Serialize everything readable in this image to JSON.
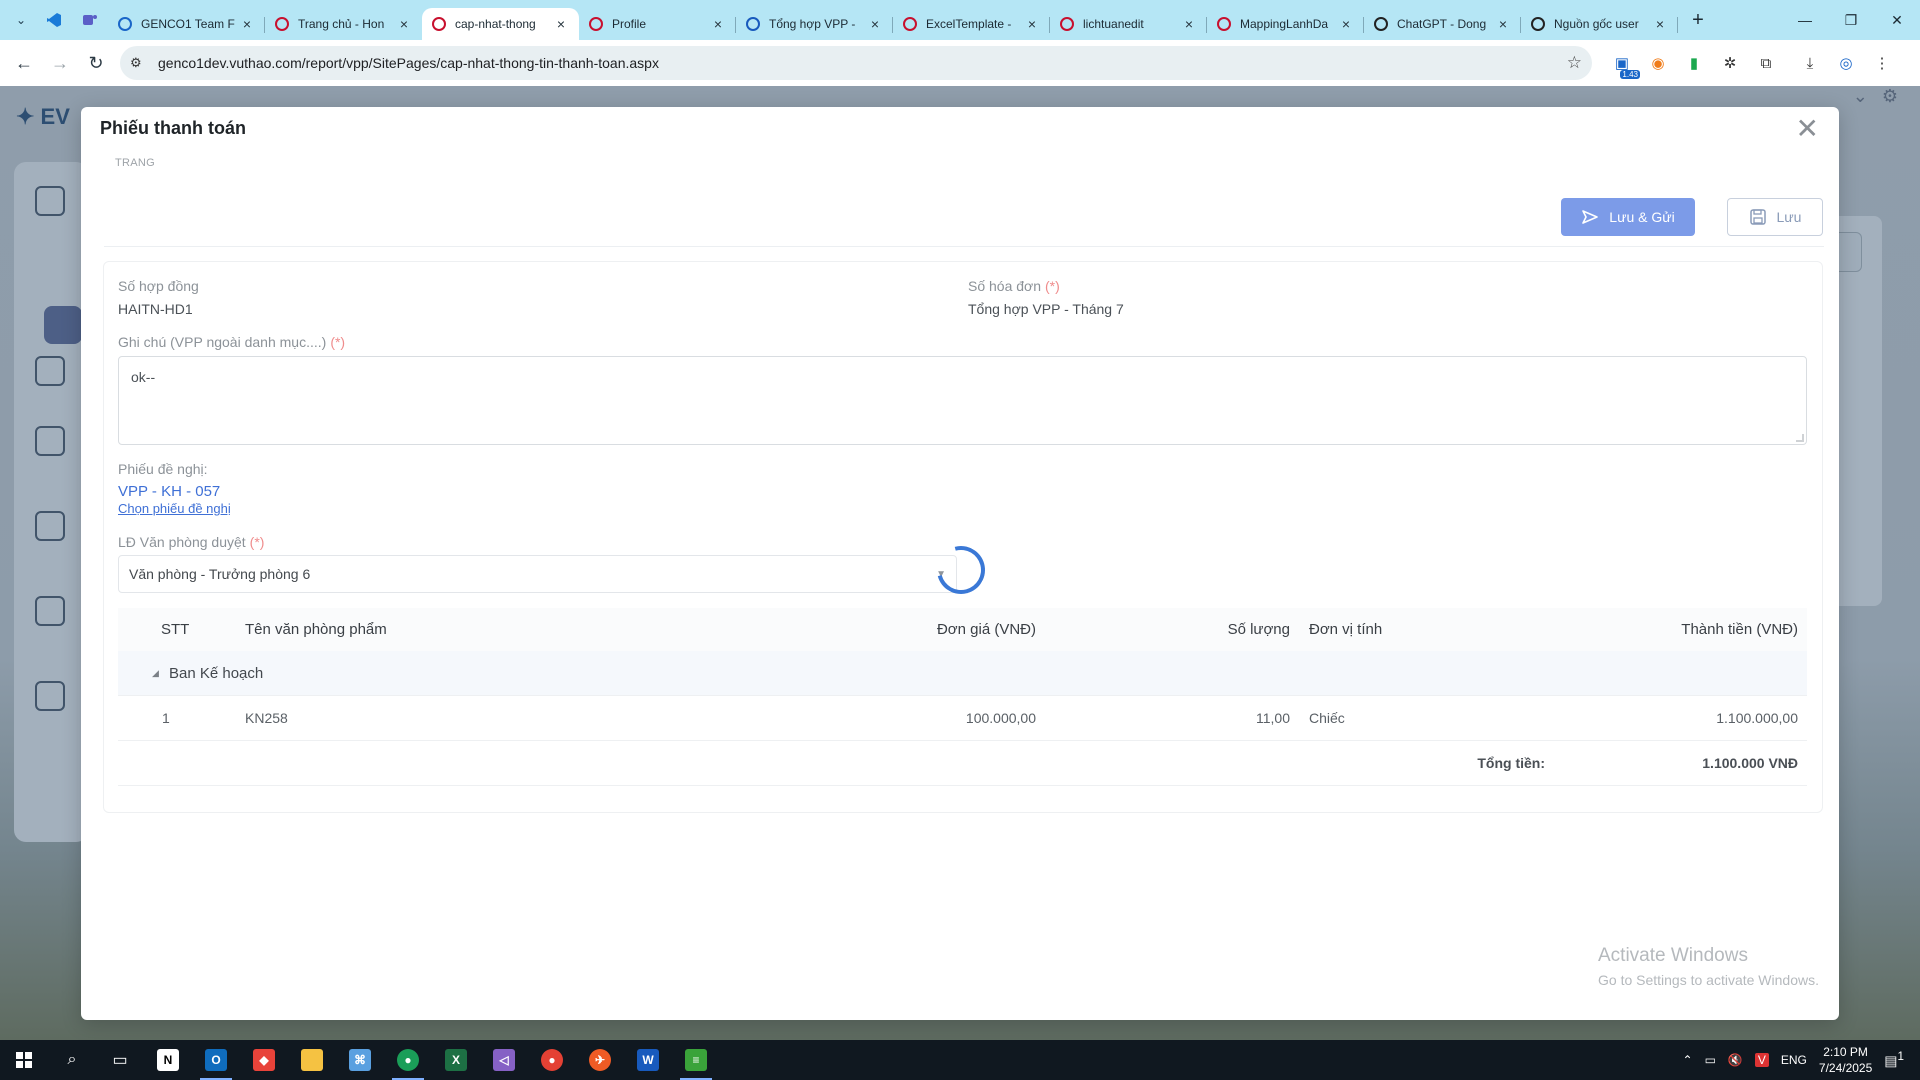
{
  "browser": {
    "tabs": [
      {
        "title": "GENCO1 Team F",
        "icon": "team-icon",
        "color": "#1a66c8"
      },
      {
        "title": "Trang chủ - Hon",
        "icon": "evn-icon",
        "color": "#c8102e"
      },
      {
        "title": "cap-nhat-thong",
        "icon": "evn-icon",
        "color": "#c8102e",
        "active": true
      },
      {
        "title": "Profile",
        "icon": "evn-icon",
        "color": "#c8102e"
      },
      {
        "title": "Tổng hợp VPP -",
        "icon": "word-icon",
        "color": "#185abd"
      },
      {
        "title": "ExcelTemplate -",
        "icon": "evn-icon",
        "color": "#c8102e"
      },
      {
        "title": "lichtuanedit",
        "icon": "evn-icon",
        "color": "#c8102e"
      },
      {
        "title": "MappingLanhDa",
        "icon": "evn-icon",
        "color": "#c8102e"
      },
      {
        "title": "ChatGPT - Dong",
        "icon": "chatgpt-icon",
        "color": "#222222"
      },
      {
        "title": "Nguồn gốc user",
        "icon": "chatgpt-icon",
        "color": "#222222"
      }
    ],
    "url": "genco1dev.vuthao.com/report/vpp/SitePages/cap-nhat-thong-tin-thanh-toan.aspx",
    "extension_badge": "1.43"
  },
  "modal": {
    "title": "Phiếu thanh toán",
    "breadcrumb": "TRANG",
    "save_send_label": "Lưu & Gửi",
    "save_label": "Lưu",
    "contract_label": "Số hợp đồng",
    "contract_value": "HAITN-HD1",
    "invoice_label": "Số hóa đơn",
    "invoice_required": "(*)",
    "invoice_value": "Tổng hợp VPP - Tháng 7",
    "note_label": "Ghi chú (VPP ngoài danh mục....)",
    "note_required": "(*)",
    "note_value": "ok--",
    "request_label": "Phiếu đề nghị:",
    "request_value": "VPP - KH - 057",
    "choose_request": "Chọn phiếu đề nghị",
    "approver_label": "LĐ Văn phòng duyệt",
    "approver_required": "(*)",
    "approver_value": "Văn phòng - Trưởng phòng 6"
  },
  "table": {
    "headers": {
      "stt": "STT",
      "name": "Tên văn phòng phẩm",
      "price": "Đơn giá (VNĐ)",
      "qty": "Số lượng",
      "unit": "Đơn vị tính",
      "amount": "Thành tiền (VNĐ)"
    },
    "group": "Ban Kế hoạch",
    "rows": [
      {
        "stt": "1",
        "name": "KN258",
        "price": "100.000,00",
        "qty": "11,00",
        "unit": "Chiếc",
        "amount": "1.100.000,00"
      }
    ],
    "total_label": "Tổng tiền:",
    "total_value": "1.100.000 VNĐ"
  },
  "watermark": {
    "line1": "Activate Windows",
    "line2": "Go to Settings to activate Windows."
  },
  "taskbar": {
    "lang": "ENG",
    "time": "2:10 PM",
    "date": "7/24/2025",
    "notif_count": "1"
  }
}
